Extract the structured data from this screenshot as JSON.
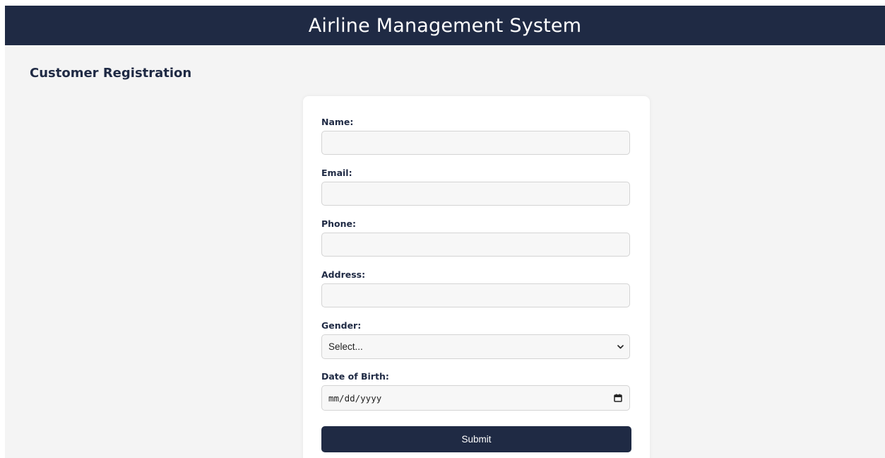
{
  "header": {
    "title": "Airline Management System"
  },
  "page": {
    "title": "Customer Registration"
  },
  "form": {
    "name_label": "Name:",
    "name_value": "",
    "email_label": "Email:",
    "email_value": "",
    "phone_label": "Phone:",
    "phone_value": "",
    "address_label": "Address:",
    "address_value": "",
    "gender_label": "Gender:",
    "gender_selected": "Select...",
    "dob_label": "Date of Birth:",
    "dob_placeholder": "mm/dd/yyyy",
    "submit_label": "Submit"
  },
  "icons": {
    "gender_dropdown": "chevron-down-icon",
    "dob_picker": "calendar-icon"
  },
  "colors": {
    "brand": "#1f2a44",
    "background": "#f4f4f4",
    "card": "#ffffff",
    "input_background": "#f7f7f7"
  }
}
